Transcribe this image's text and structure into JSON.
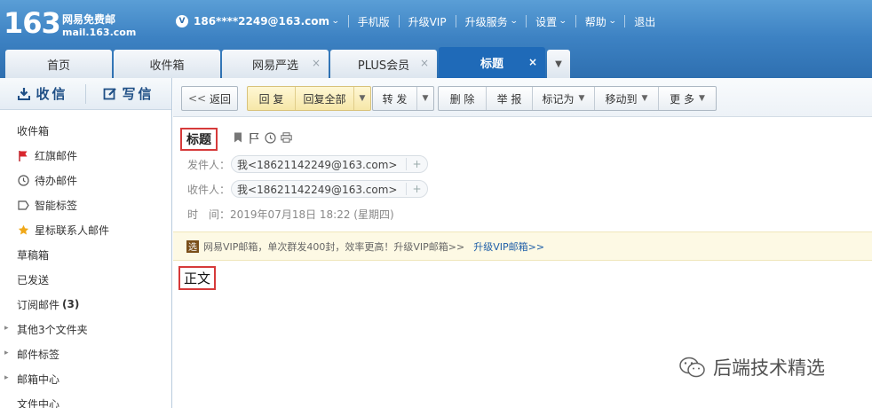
{
  "logo": {
    "number": "163",
    "name": "网易免费邮",
    "domain": "mail.163.com"
  },
  "topnav": {
    "vip_badge": "V",
    "account": "186****2249@163.com",
    "links": [
      "手机版",
      "升级VIP",
      "升级服务",
      "设置",
      "帮助",
      "退出"
    ]
  },
  "tabs": [
    {
      "label": "首页"
    },
    {
      "label": "收件箱"
    },
    {
      "label": "网易严选",
      "close": "×"
    },
    {
      "label": "PLUS会员",
      "close": "×"
    },
    {
      "label": "标题",
      "close": "×"
    }
  ],
  "sidebar": {
    "receive": "收信",
    "compose": "写信",
    "folders": [
      {
        "label": "收件箱"
      },
      {
        "label": "红旗邮件",
        "icon": "flag-icon"
      },
      {
        "label": "待办邮件",
        "icon": "clock-icon"
      },
      {
        "label": "智能标签",
        "icon": "tag-icon"
      },
      {
        "label": "星标联系人邮件",
        "icon": "star-icon"
      },
      {
        "label": "草稿箱"
      },
      {
        "label": "已发送"
      },
      {
        "label": "订阅邮件",
        "count": "(3)"
      },
      {
        "label": "其他3个文件夹",
        "arrow": true
      },
      {
        "label": "邮件标签",
        "arrow": true
      },
      {
        "label": "邮箱中心",
        "arrow": true
      },
      {
        "label": "文件中心"
      }
    ]
  },
  "toolbar": {
    "back": "返回",
    "reply": "回 复",
    "reply_all": "回复全部",
    "forward": "转 发",
    "delete": "删 除",
    "report": "举 报",
    "mark_as": "标记为",
    "move_to": "移动到",
    "more": "更 多"
  },
  "message": {
    "subject": "标题",
    "from_label": "发件人：",
    "from_value": "我<18621142249@163.com>",
    "to_label": "收件人：",
    "to_value": "我<18621142249@163.com>",
    "time_label": "时　间：",
    "time_value": "2019年07月18日 18:22 (星期四)",
    "plus": "+",
    "body": "正文"
  },
  "vip_bar": {
    "badge": "选",
    "text": "网易VIP邮箱，单次群发400封，效率更高！升级VIP邮箱>>",
    "link": "升级VIP邮箱>>"
  },
  "watermark": "后端技术精选",
  "colors": {
    "header": "#3d82c3",
    "active_tab": "#1f6ab8",
    "highlight_border": "#d63a3a",
    "vip_bar": "#fdf9e4"
  }
}
